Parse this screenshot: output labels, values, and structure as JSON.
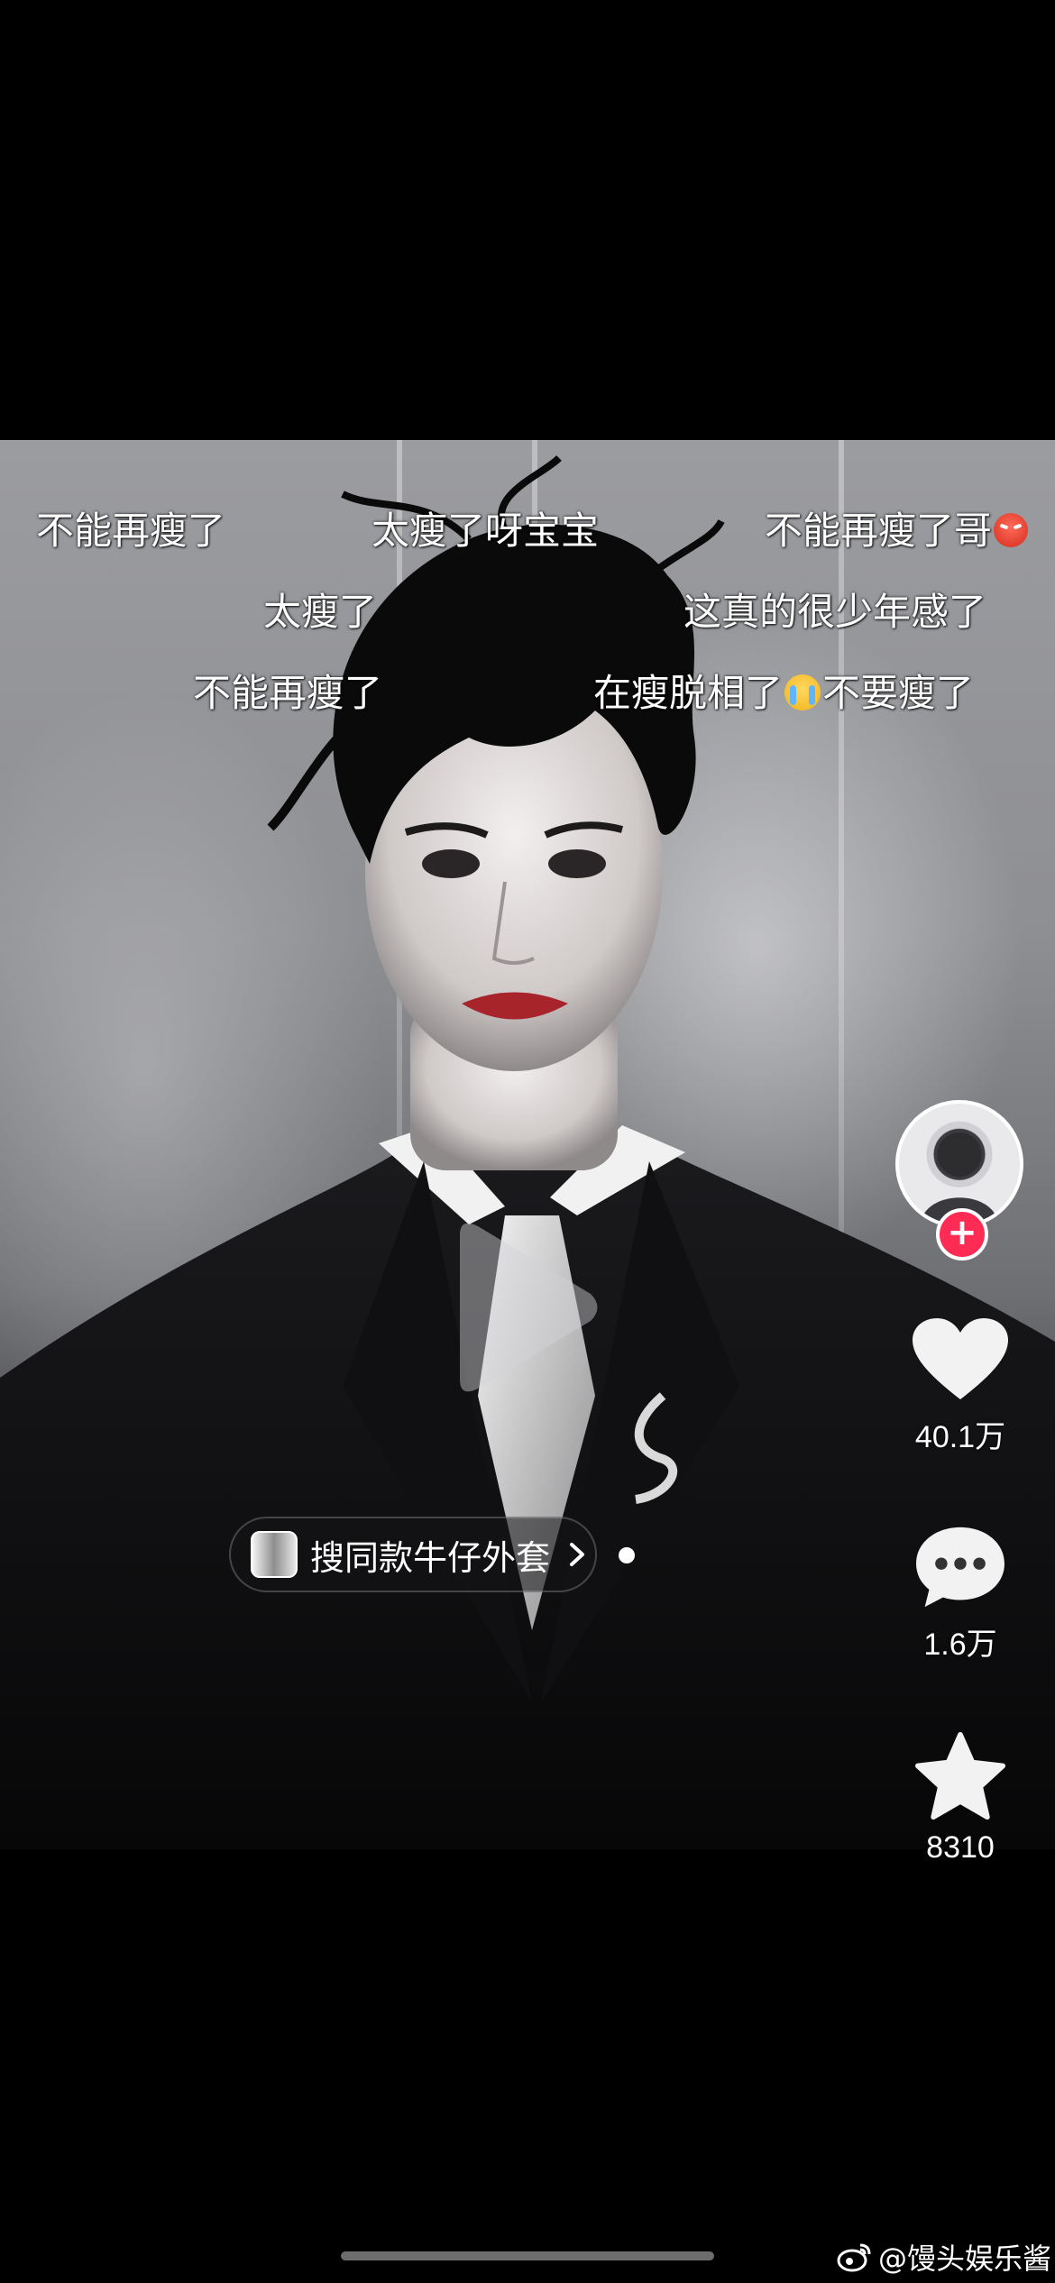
{
  "danmaku": [
    {
      "text": "不能再瘦了"
    },
    {
      "text": "太瘦了呀宝宝"
    },
    {
      "text": "不能再瘦了哥",
      "emoji": "angry-emoji"
    },
    {
      "text": "太瘦了"
    },
    {
      "text": "这真的很少年感了"
    },
    {
      "text": "不能再瘦了"
    },
    {
      "text_before": "在瘦脱相了",
      "emoji": "crying-emoji",
      "text_after": "不要瘦了"
    }
  ],
  "shop": {
    "label": "搜同款牛仔外套",
    "icon": "chevron-right-icon"
  },
  "rail": {
    "follow_symbol": "+",
    "like_count": "40.1万",
    "comment_count": "1.6万",
    "favorite_count": "8310"
  },
  "watermark": {
    "text": "@馒头娱乐酱",
    "icon": "weibo-icon"
  },
  "colors": {
    "accent": "#fe2c55",
    "background": "#000000"
  }
}
